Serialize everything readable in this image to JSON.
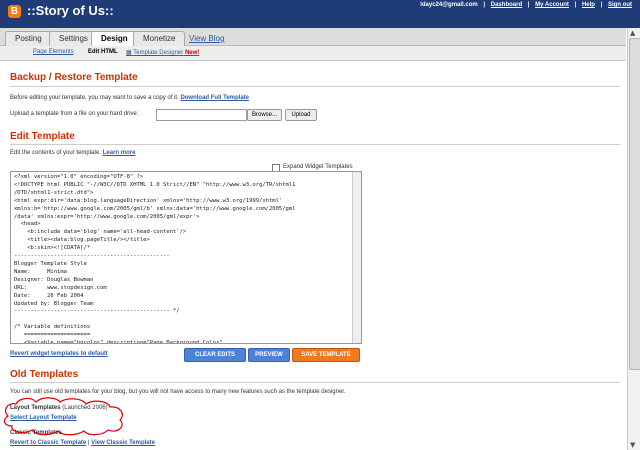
{
  "header": {
    "logo_glyph": "B",
    "blog_title": "::Story of Us::",
    "user_email": "ldayc24@gmail.com",
    "links": [
      "Dashboard",
      "My Account",
      "Help",
      "Sign out"
    ]
  },
  "tabs": {
    "items": [
      "Posting",
      "Settings",
      "Design",
      "Monetize"
    ],
    "active": "Design",
    "view_blog": "View Blog"
  },
  "subtabs": {
    "page_elements": "Page Elements",
    "edit_html": "Edit HTML",
    "template_designer": "Template Designer",
    "new_badge": "New!"
  },
  "backup": {
    "heading": "Backup / Restore Template",
    "intro": "Before editing your template, you may want to save a copy of it.",
    "download_link": "Download Full Template",
    "upload_label": "Upload a template from a file on your hard drive:",
    "browse": "Browse...",
    "upload": "Upload"
  },
  "edit": {
    "heading": "Edit Template",
    "intro": "Edit the contents of your template.",
    "learn_more": "Learn more",
    "expand_label": "Expand Widget Templates",
    "code": "<?xml version=\"1.0\" encoding=\"UTF-8\" ?>\n<!DOCTYPE html PUBLIC \"-//W3C//DTD XHTML 1.0 Strict//EN\" \"http://www.w3.org/TR/xhtml1\n/DTD/xhtml1-strict.dtd\">\n<html expr:dir='data:blog.languageDirection' xmlns='http://www.w3.org/1999/xhtml'\nxmlns:b='http://www.google.com/2005/gml/b' xmlns:data='http://www.google.com/2005/gml\n/data' xmlns:expr='http://www.google.com/2005/gml/expr'>\n  <head>\n    <b:include data='blog' name='all-head-content'/>\n    <title><data:blog.pageTitle/></title>\n    <b:skin><![CDATA[/*\n-----------------------------------------------\nBlogger Template Style\nName:     Minima\nDesigner: Douglas Bowman\nURL:      www.stopdesign.com\nDate:     26 Feb 2004\nUpdated by: Blogger Team\n----------------------------------------------- */\n\n/* Variable definitions\n   ====================\n   <Variable name=\"bgcolor\" description=\"Page Background Color\"",
    "revert_link": "Revert widget templates to default",
    "clear_edits": "CLEAR EDITS",
    "preview": "PREVIEW",
    "save": "SAVE TEMPLATE"
  },
  "old": {
    "heading": "Old Templates",
    "intro": "You can still use old templates for your blog, but you will not have access to many new features such as the template designer.",
    "layout_label": "Layout Templates",
    "launched": "(Launched 2006)",
    "select_layout": "Select Layout Template",
    "classic_label": "Classic Templates",
    "revert_classic": "Revert to Classic Template",
    "separator": "|",
    "view_classic": "View Classic Template"
  },
  "colors": {
    "header_bg": "#1e3c78",
    "heading": "#cc3300",
    "link": "#2d5aa0",
    "save_button": "#ef7a1f",
    "blue_button": "#4d83d6",
    "annotation": "#dd0000"
  }
}
